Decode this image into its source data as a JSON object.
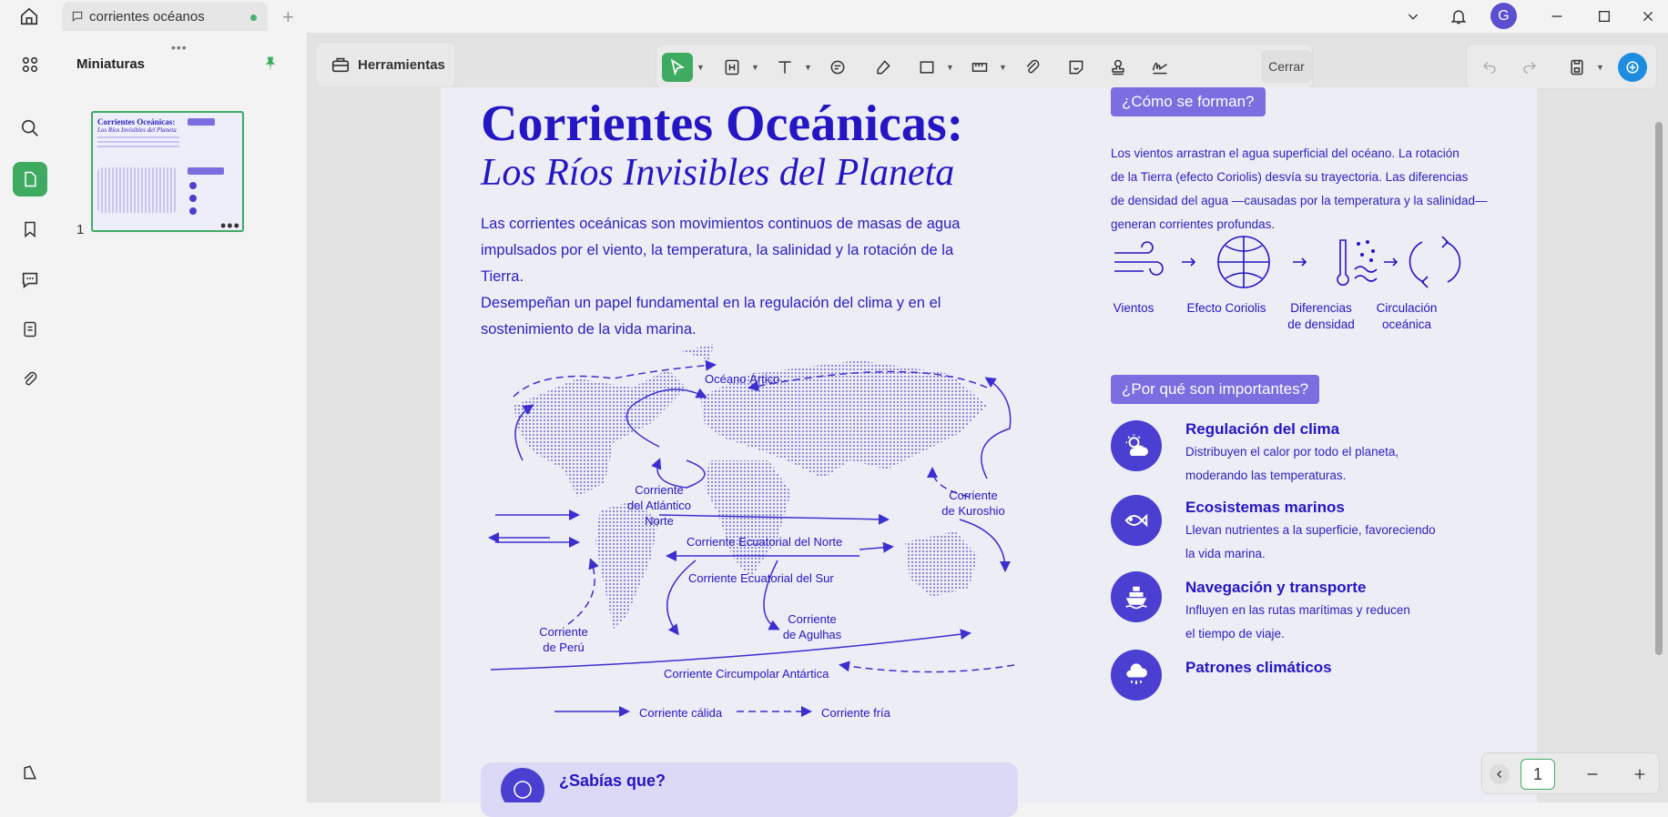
{
  "titlebar": {
    "tab_title": "corrientes océanos",
    "avatar_letter": "G"
  },
  "sidebar_panel": {
    "title": "Miniaturas",
    "page_number": "1"
  },
  "toolbar": {
    "tools_label": "Herramientas",
    "close_label": "Cerrar"
  },
  "pager": {
    "current_page": "1"
  },
  "document": {
    "title": "Corrientes Oceánicas:",
    "subtitle": "Los Ríos Invisibles del Planeta",
    "intro_lines": [
      "Las corrientes oceánicas son movimientos continuos de masas de agua",
      "impulsados por el viento, la temperatura, la salinidad y la rotación de la Tierra.",
      "Desempeñan un papel fundamental en la regulación del clima y en el",
      "sostenimiento de la vida marina."
    ],
    "map_labels": {
      "arctic": "Océano Ártico",
      "north_atlantic_1": "Corriente",
      "north_atlantic_2": "del Atlántico",
      "north_atlantic_3": "Norte",
      "kuroshio_1": "Corriente",
      "kuroshio_2": "de Kuroshio",
      "north_equatorial": "Corriente Ecuatorial del Norte",
      "south_equatorial": "Corriente Ecuatorial del Sur",
      "peru_1": "Corriente",
      "peru_2": "de Perú",
      "agulhas_1": "Corriente",
      "agulhas_2": "de Agulhas",
      "circumpolar": "Corriente Circumpolar Antártica"
    },
    "legend": {
      "warm": "Corriente cálida",
      "cold": "Corriente fría"
    },
    "how_title": "¿Cómo se forman?",
    "how_lines": [
      "Los vientos arrastran el agua superficial del océano. La rotación",
      "de la Tierra (efecto Coriolis) desvía su trayectoria. Las diferencias",
      "de densidad del agua —causadas por la temperatura y la salinidad—",
      "generan corrientes profundas."
    ],
    "steps": [
      {
        "label1": "Vientos",
        "label2": ""
      },
      {
        "label1": "Efecto Coriolis",
        "label2": ""
      },
      {
        "label1": "Diferencias",
        "label2": "de densidad"
      },
      {
        "label1": "Circulación",
        "label2": "oceánica"
      }
    ],
    "why_title": "¿Por qué son importantes?",
    "importance": [
      {
        "title": "Regulación del clima",
        "line1": "Distribuyen el calor por todo el planeta,",
        "line2": "moderando las temperaturas."
      },
      {
        "title": "Ecosistemas marinos",
        "line1": "Llevan nutrientes a la superficie, favoreciendo",
        "line2": "la vida marina."
      },
      {
        "title": "Navegación y transporte",
        "line1": "Influyen en las rutas marítimas  y reducen",
        "line2": "el tiempo de viaje."
      },
      {
        "title": "Patrones climáticos",
        "line1": "",
        "line2": ""
      }
    ],
    "fact_title": "¿Sabías que?"
  },
  "thumbnail": {
    "title": "Corrientes Oceánicas:",
    "subtitle": "Los Ríos Invisibles del Planeta"
  },
  "colors": {
    "accent_green": "#3fab62",
    "doc_blue": "#2416c4",
    "pill_purple": "#7a6ee0"
  }
}
